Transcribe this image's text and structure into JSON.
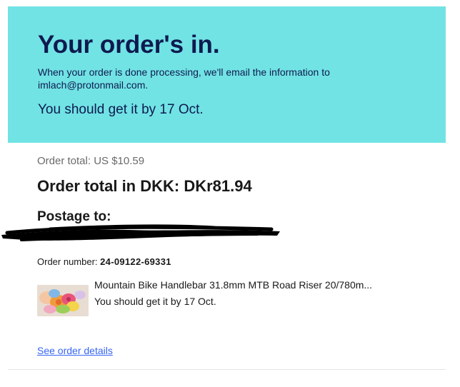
{
  "banner": {
    "title": "Your order's in.",
    "subtitle_line1": "When your order is done processing, we'll email the information to",
    "subtitle_line2": "imlach@protonmail.com.",
    "eta": "You should get it by 17 Oct."
  },
  "summary": {
    "order_total_usd": "Order total: US $10.59",
    "order_total_dkk": "Order total in DKK: DKr81.94",
    "postage_label": "Postage to:",
    "order_number_label": "Order number: ",
    "order_number_value": "24-09122-69331"
  },
  "item": {
    "title": "Mountain Bike Handlebar 31.8mm MTB Road Riser 20/780m...",
    "eta": "You should get it by 17 Oct."
  },
  "links": {
    "see_order_details": "See order details"
  },
  "colors": {
    "banner_bg": "#71e3e4",
    "banner_text": "#0f1a4f",
    "link": "#3665f3"
  }
}
